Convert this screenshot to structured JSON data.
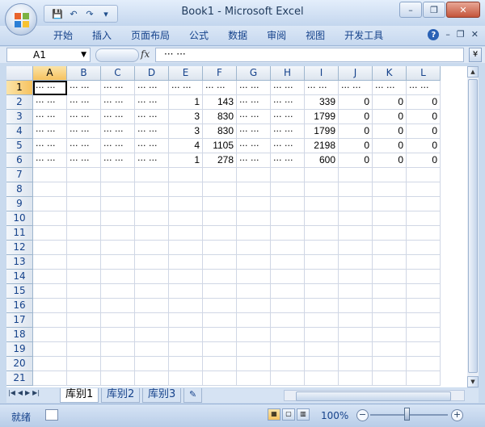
{
  "window": {
    "title": "Book1 - Microsoft Excel",
    "minimize": "–",
    "restore": "❐",
    "close": "✕"
  },
  "qat": {
    "save": "💾",
    "undo": "↶",
    "redo": "↷",
    "customize": "▾"
  },
  "ribbon": {
    "tabs": [
      "开始",
      "插入",
      "页面布局",
      "公式",
      "数据",
      "审阅",
      "视图",
      "开发工具"
    ],
    "help": "?",
    "minimize": "–",
    "restore": "❐",
    "close": "✕"
  },
  "formula_bar": {
    "name_box": "A1",
    "fx": "fx",
    "content": "··· ···",
    "expand": "¥"
  },
  "columns": [
    "A",
    "B",
    "C",
    "D",
    "E",
    "F",
    "G",
    "H",
    "I",
    "J",
    "K",
    "L"
  ],
  "active_cell": "A1",
  "rows": [
    [
      "··· ···",
      "··· ···",
      "··· ···",
      "··· ···",
      "··· ···",
      "··· ···",
      "··· ···",
      "··· ···",
      "··· ···",
      "··· ···",
      "··· ···",
      "··· ···"
    ],
    [
      "··· ···",
      "··· ···",
      "··· ···",
      "··· ···",
      "1",
      "143",
      "··· ···",
      "··· ···",
      "339",
      "0",
      "0",
      "0"
    ],
    [
      "··· ···",
      "··· ···",
      "··· ···",
      "··· ···",
      "3",
      "830",
      "··· ···",
      "··· ···",
      "1799",
      "0",
      "0",
      "0"
    ],
    [
      "··· ···",
      "··· ···",
      "··· ···",
      "··· ···",
      "3",
      "830",
      "··· ···",
      "··· ···",
      "1799",
      "0",
      "0",
      "0"
    ],
    [
      "··· ···",
      "··· ···",
      "··· ···",
      "··· ···",
      "4",
      "1105",
      "··· ···",
      "··· ···",
      "2198",
      "0",
      "0",
      "0"
    ],
    [
      "··· ···",
      "··· ···",
      "··· ···",
      "··· ···",
      "1",
      "278",
      "··· ···",
      "··· ···",
      "600",
      "0",
      "0",
      "0"
    ]
  ],
  "row_numbers": [
    "1",
    "2",
    "3",
    "4",
    "5",
    "6",
    "7",
    "8",
    "9",
    "10",
    "11",
    "12",
    "13",
    "14",
    "15",
    "16",
    "17",
    "18",
    "19",
    "20",
    "21"
  ],
  "sheet_tabs": [
    "库别1",
    "库别2",
    "库别3"
  ],
  "active_sheet": "库别1",
  "status": {
    "ready": "就绪",
    "zoom": "100%"
  }
}
